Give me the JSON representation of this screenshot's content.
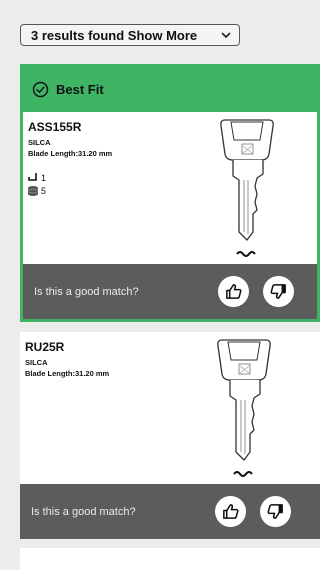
{
  "results": {
    "label": "3 results found Show More",
    "icon": "chevron-down-icon"
  },
  "cards": [
    {
      "badge": "Best Fit",
      "badge_icon": "check-circle-icon",
      "name": "ASS155R",
      "brand": "SILCA",
      "blade_length": "Blade Length:31.20 mm",
      "cuts": "1",
      "shoulders": "5",
      "question": "Is this a good match?"
    },
    {
      "name": "RU25R",
      "brand": "SILCA",
      "blade_length": "Blade Length:31.20 mm",
      "question": "Is this a good match?"
    }
  ],
  "colors": {
    "accent": "#3fb464",
    "match_bar": "#5c5c5c",
    "background": "#ececec"
  }
}
